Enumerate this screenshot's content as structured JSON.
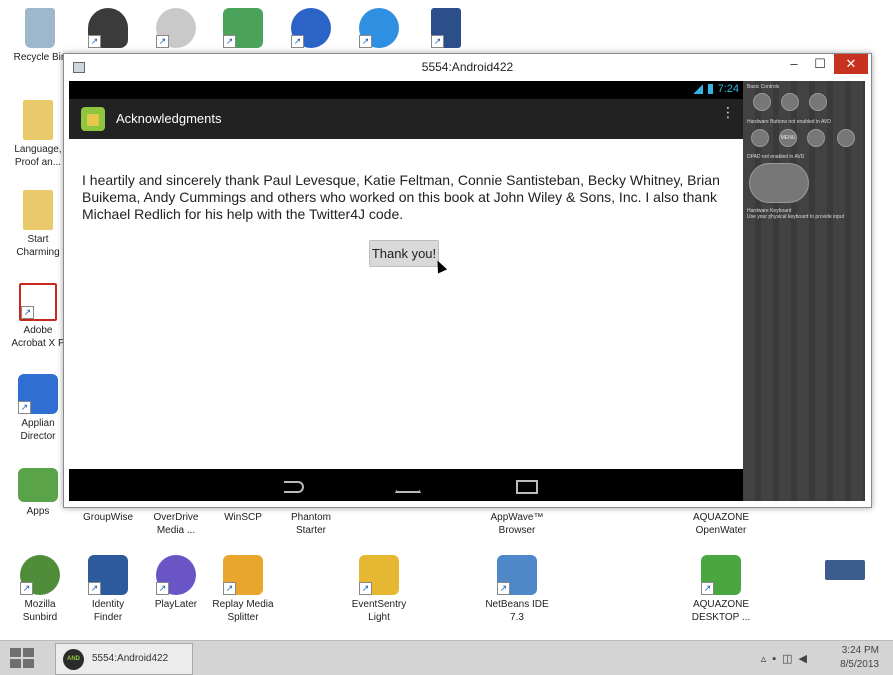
{
  "desktop": {
    "top_row": [
      {
        "name": "recycle-bin-icon",
        "label": "Recycle Bin",
        "color": "#9db8cc"
      },
      {
        "name": "person-icon",
        "label": "",
        "color": "#3b3b3b"
      },
      {
        "name": "hand-icon",
        "label": "",
        "color": "#c9c9c9"
      },
      {
        "name": "monitor-icon",
        "label": "",
        "color": "#4ba35a"
      },
      {
        "name": "browser-icon",
        "label": "",
        "color": "#2b63c6"
      },
      {
        "name": "itunes-icon",
        "label": "",
        "color": "#2f8fe0"
      },
      {
        "name": "calculator-icon",
        "label": "",
        "color": "#2c4f8a"
      }
    ],
    "left_column": [
      {
        "name": "folder-icon",
        "label": "Language,\nProof an...",
        "color": "#e9c96b"
      },
      {
        "name": "folder-icon",
        "label": "Start\nCharming",
        "color": "#e9c96b"
      },
      {
        "name": "pdf-icon",
        "label": "Adobe\nAcrobat X P",
        "color": "#c8281b"
      },
      {
        "name": "app-director-icon",
        "label": "Applian\nDirector",
        "color": "#2e6fd1"
      },
      {
        "name": "apps-icon",
        "label": "Apps",
        "color": "#5ba348"
      }
    ],
    "bottom_labels": [
      "GroupWise",
      "OverDrive\nMedia ...",
      "WinSCP",
      "Phantom\nStarter",
      "AppWave™\nBrowser",
      "AQUAZONE\nOpenWater"
    ],
    "bottom_row": [
      {
        "name": "sunbird-icon",
        "label": "Mozilla\nSunbird",
        "color": "#4f8d3a"
      },
      {
        "name": "identity-finder-icon",
        "label": "Identity\nFinder",
        "color": "#2c5a9c"
      },
      {
        "name": "playlater-icon",
        "label": "PlayLater",
        "color": "#6a55c6"
      },
      {
        "name": "replay-media-icon",
        "label": "Replay Media\nSplitter",
        "color": "#e8a72c"
      },
      {
        "name": "eventsentry-icon",
        "label": "EventSentry\nLight",
        "color": "#e6b730"
      },
      {
        "name": "netbeans-icon",
        "label": "NetBeans IDE\n7.3",
        "color": "#4f88c8"
      },
      {
        "name": "aquazone-icon",
        "label": "AQUAZONE\nDESKTOP ...",
        "color": "#4aa640"
      },
      {
        "name": "network-icon",
        "label": "",
        "color": "#3a5b8c"
      }
    ]
  },
  "window": {
    "title": "5554:Android422",
    "controls": {
      "minimize": "–",
      "maximize": "☐",
      "close": "✕"
    }
  },
  "android": {
    "status_time": "7:24",
    "action_title": "Acknowledgments",
    "overflow": "⋮",
    "message": "I heartily and sincerely thank Paul Levesque, Katie Feltman, Connie Santisteban, Becky Whitney, Brian Buikema, Andy Cummings and others who worked on this book at John Wiley & Sons, Inc. I also thank Michael Redlich for his help with the Twitter4J code.",
    "button_label": "Thank you!"
  },
  "emulator_controls": {
    "basic_controls": "Basic Controls",
    "hardware_buttons": "Hardware Buttons not enabled in AVD",
    "dpad": "DPAD not enabled in AVD",
    "keyboard": "Hardware Keyboard",
    "keyboard_hint": "Use your physical keyboard to provide input",
    "menu": "MENU"
  },
  "taskbar": {
    "task_label": "5554:Android422",
    "task_icon_text": "AND",
    "clock_time": "3:24 PM",
    "clock_date": "8/5/2013"
  },
  "colors": {
    "accent": "#33b5e5",
    "close": "#c7311f",
    "taskbar": "#d4d4d4",
    "action_bar": "#222222"
  }
}
